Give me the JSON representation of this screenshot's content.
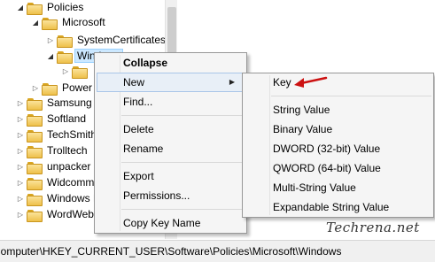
{
  "tree": {
    "items": [
      {
        "label": "Policies",
        "expanded": true
      },
      {
        "label": "Microsoft",
        "expanded": true
      },
      {
        "label": "SystemCertificates",
        "expanded": false
      },
      {
        "label": "Windows",
        "expanded": true
      },
      {
        "label": "",
        "expanded": false
      },
      {
        "label": "Power",
        "expanded": false
      },
      {
        "label": "Samsung",
        "expanded": false
      },
      {
        "label": "Softland",
        "expanded": false
      },
      {
        "label": "TechSmith",
        "expanded": false
      },
      {
        "label": "Trolltech",
        "expanded": false
      },
      {
        "label": "unpacker",
        "expanded": false
      },
      {
        "label": "Widcomm",
        "expanded": false
      },
      {
        "label": "Windows L",
        "expanded": false
      },
      {
        "label": "WordWeb",
        "expanded": false
      }
    ]
  },
  "context_menu": {
    "items": [
      {
        "label": "Collapse"
      },
      {
        "label": "New"
      },
      {
        "label": "Find..."
      },
      {
        "label": "Delete"
      },
      {
        "label": "Rename"
      },
      {
        "label": "Export"
      },
      {
        "label": "Permissions..."
      },
      {
        "label": "Copy Key Name"
      }
    ]
  },
  "new_submenu": {
    "items": [
      {
        "label": "Key"
      },
      {
        "label": "String Value"
      },
      {
        "label": "Binary Value"
      },
      {
        "label": "DWORD (32-bit) Value"
      },
      {
        "label": "QWORD (64-bit) Value"
      },
      {
        "label": "Multi-String Value"
      },
      {
        "label": "Expandable String Value"
      }
    ]
  },
  "statusbar": {
    "path": "Computer\\HKEY_CURRENT_USER\\Software\\Policies\\Microsoft\\Windows"
  },
  "watermark": {
    "text": "Techrena.net"
  },
  "colors": {
    "selection": "#cce8ff",
    "menu_bg": "#f5f5f5",
    "arrow_red": "#cc1111",
    "folder": "#eec04a"
  }
}
